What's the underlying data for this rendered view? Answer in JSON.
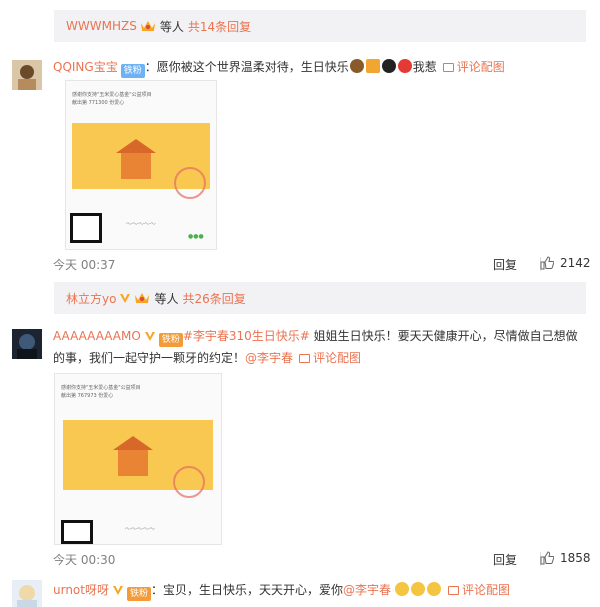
{
  "reply_bar_1": {
    "user": "WWWMHZS",
    "mid": "等人",
    "count": "共14条回复"
  },
  "comment_1": {
    "user": "QQING宝宝",
    "fan_badge": "铁粉",
    "text": "：愿你被这个世界温柔对待，生日快乐",
    "suffix": "我惹",
    "pic_link": "评论配图",
    "image_caption_1": "感谢你支持\"玉米爱心基金\"公益项目",
    "image_caption_2": "献出第 771300 份爱心",
    "time": "今天 00:37",
    "reply": "回复",
    "likes": "2142"
  },
  "reply_bar_2": {
    "user": "林立方yo",
    "mid": "等人",
    "count": "共26条回复"
  },
  "comment_2": {
    "user": "AAAAAAAAMO",
    "fan_badge": "铁粉",
    "topic": "#李宇春310生日快乐#",
    "text": " 姐姐生日快乐！要天天健康开心，尽情做自己想做的事，我们一起守护一颗牙的约定！",
    "at": "@李宇春",
    "pic_link": "评论配图",
    "image_caption_1": "感谢你支持\"玉米爱心基金\"公益项目",
    "image_caption_2": "献出第 767973 份爱心",
    "time": "今天 00:30",
    "reply": "回复",
    "likes": "1858"
  },
  "comment_3": {
    "user": "urnot呀呀",
    "fan_badge": "铁粉",
    "text": "：宝贝，生日快乐，天天开心，爱你",
    "at": "@李宇春",
    "pic_link": "评论配图"
  },
  "colors": {
    "accent": "#eb7350",
    "fan_blue": "#6db2f4",
    "fan_gold": "#f29b38",
    "card": "#f9c851"
  }
}
